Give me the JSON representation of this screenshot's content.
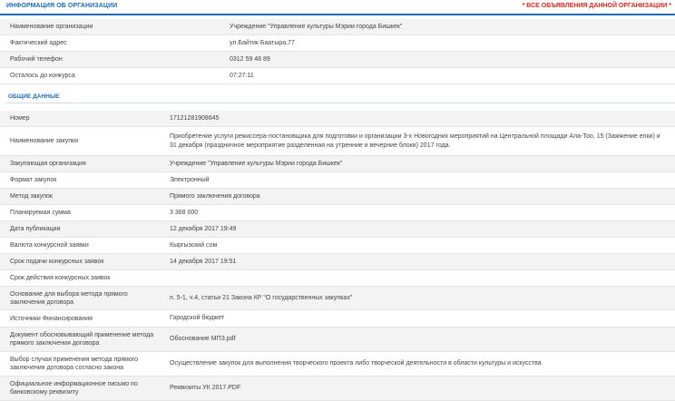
{
  "org": {
    "title": "ИНФОРМАЦИЯ ОБ ОРГАНИЗАЦИИ",
    "note": "* ВСЕ ОБЪЯВЛЕНИЯ ДАННОЙ ОРГАНИЗАЦИИ *",
    "rows": [
      {
        "label": "Наименование организации",
        "value": "Учреждение \"Управление культуры Мэрии города Бишкек\""
      },
      {
        "label": "Фактический адрес",
        "value": "ул.Байтик Баатыра,77"
      },
      {
        "label": "Рабочий телефон",
        "value": "0312 59 48 89"
      },
      {
        "label": "Осталось до конкурса",
        "value": "07:27:11"
      }
    ]
  },
  "general": {
    "title": "ОБЩИЕ ДАННЫЕ",
    "rows": [
      {
        "label": "Номер",
        "value": "17121281908645"
      },
      {
        "label": "Наименование закупки",
        "value": "Приобретение услуги режиссера-постановщика для подготовки и организации 3-х Новогодних мероприятий на Центральной площади Ала-Тоо, 15 (Зажжение елки) и 31 декабря (праздничное мероприятие разделенная на утренние и вечерние блоки) 2017 года."
      },
      {
        "label": "Закупающая организация",
        "value": "Учреждение \"Управление культуры Мэрии города Бишкек\""
      },
      {
        "label": "Формат закупок",
        "value": "Электронный"
      },
      {
        "label": "Метод закупок",
        "value": "Прямого заключения договора"
      },
      {
        "label": "Планируемая сумма",
        "value": "3 368 000"
      },
      {
        "label": "Дата публикации",
        "value": "12 декабря 2017 19:49"
      },
      {
        "label": "Валюта конкурсной заявки",
        "value": "Кыргызский сом"
      },
      {
        "label": "Срок подачи конкурсных заявок",
        "value": "14 декабря 2017 19:51"
      },
      {
        "label": "Срок действия конкурсных заявок",
        "value": ""
      },
      {
        "label": "Основание для выбора метода прямого заключения договора",
        "value": "п. 5-1, ч.4, статьи 21 Закона КР \"О государственных закупках\""
      },
      {
        "label": "Источники Финансирования",
        "value": "Городской бюджет"
      },
      {
        "label": "Документ обосновывающий применение метода прямого заключения договора",
        "value": "Обоснование МПЗ.pdf"
      },
      {
        "label": "Выбор случая применения метода прямого заключения договора согласно закона",
        "value": "Осуществление закупок для выполнения творческого проекта либо творческой деятельности в области культуры и искусства"
      },
      {
        "label": "Официальное информационное письмо по банковскому реквизиту",
        "value": "Реквизиты УК 2017.PDF"
      }
    ]
  }
}
